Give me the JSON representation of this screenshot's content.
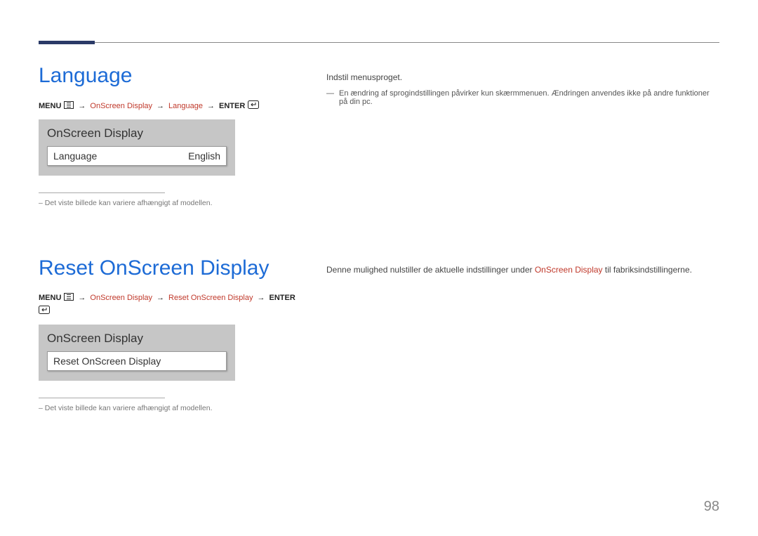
{
  "page_number": "98",
  "section1": {
    "title": "Language",
    "breadcrumb": {
      "menu": "MENU",
      "path1": "OnScreen Display",
      "path2": "Language",
      "enter": "ENTER"
    },
    "panel": {
      "title": "OnScreen Display",
      "row_label": "Language",
      "row_value": "English"
    },
    "note": "Det viste billede kan variere afhængigt af modellen.",
    "desc": "Indstil menusproget.",
    "dash_note": "En ændring af sprogindstillingen påvirker kun skærmmenuen. Ændringen anvendes ikke på andre funktioner på din pc."
  },
  "section2": {
    "title": "Reset OnScreen Display",
    "breadcrumb": {
      "menu": "MENU",
      "path1": "OnScreen Display",
      "path2": "Reset OnScreen Display",
      "enter": "ENTER"
    },
    "panel": {
      "title": "OnScreen Display",
      "row_label": "Reset OnScreen Display"
    },
    "note": "Det viste billede kan variere afhængigt af modellen.",
    "desc_pre": "Denne mulighed nulstiller de aktuelle indstillinger under ",
    "desc_hl": "OnScreen Display",
    "desc_post": " til fabriksindstillingerne."
  }
}
